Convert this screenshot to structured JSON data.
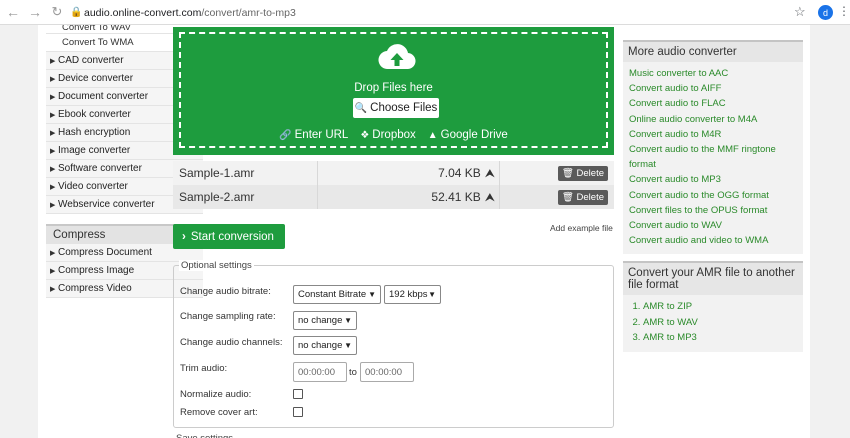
{
  "browser": {
    "url_host": "audio.online-convert.com",
    "url_path": "/convert/amr-to-mp3",
    "avatar_letter": "d"
  },
  "left_sidebar": {
    "top_sub_cut": "Convert To WAV",
    "top_sub": "Convert To WMA",
    "items": [
      "CAD converter",
      "Device converter",
      "Document converter",
      "Ebook converter",
      "Hash encryption",
      "Image converter",
      "Software converter",
      "Video converter",
      "Webservice converter"
    ],
    "compress_title": "Compress",
    "compress_items": [
      "Compress Document",
      "Compress Image",
      "Compress Video"
    ]
  },
  "dropzone": {
    "drop_text": "Drop Files here",
    "choose_label": "Choose Files",
    "enter_url": "Enter URL",
    "dropbox": "Dropbox",
    "google_drive": "Google Drive"
  },
  "files": [
    {
      "name": "Sample-1.amr",
      "size": "7.04 KB",
      "delete": "Delete"
    },
    {
      "name": "Sample-2.amr",
      "size": "52.41 KB",
      "delete": "Delete"
    }
  ],
  "add_example": "Add example file",
  "start_label": "Start conversion",
  "optional": {
    "legend": "Optional settings",
    "bitrate_label": "Change audio bitrate:",
    "bitrate_mode": "Constant Bitrate",
    "bitrate_value": "192 kbps",
    "sampling_label": "Change sampling rate:",
    "sampling_value": "no change",
    "channels_label": "Change audio channels:",
    "channels_value": "no change",
    "trim_label": "Trim audio:",
    "trim_from": "00:00:00",
    "trim_to_word": "to",
    "trim_to": "00:00:00",
    "normalize_label": "Normalize audio:",
    "cover_label": "Remove cover art:",
    "cut_text": "Save settings"
  },
  "more_audio": {
    "title": "More audio converter",
    "links": [
      "Music converter to AAC",
      "Convert audio to AIFF",
      "Convert audio to FLAC",
      "Online audio converter to M4A",
      "Convert audio to M4R",
      "Convert audio to the MMF ringtone format",
      "Convert audio to MP3",
      "Convert audio to the OGG format",
      "Convert files to the OPUS format",
      "Convert audio to WAV",
      "Convert audio and video to WMA"
    ]
  },
  "amr_panel": {
    "title": "Convert your AMR file to another file format",
    "items": [
      "AMR to ZIP",
      "AMR to WAV",
      "AMR to MP3"
    ]
  }
}
